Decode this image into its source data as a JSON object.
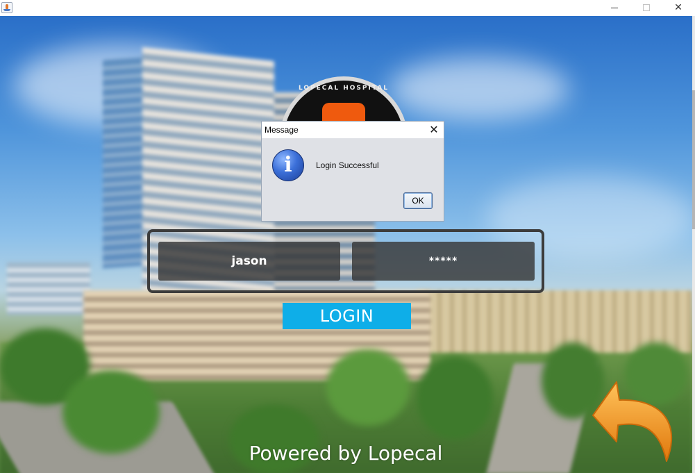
{
  "window": {
    "minimize_icon": "minimize-icon",
    "maximize_icon": "maximize-icon",
    "close_glyph": "✕"
  },
  "login": {
    "username_value": "jason",
    "password_value": "*****",
    "login_label": "LOGIN"
  },
  "logo": {
    "text": "LOPECAL HOSPITAL"
  },
  "footer": {
    "powered_by": "Powered by Lopecal"
  },
  "dialog": {
    "title": "Message",
    "close_glyph": "✕",
    "icon": "info-icon",
    "icon_glyph": "i",
    "message": "Login Successful",
    "ok_label": "OK"
  },
  "colors": {
    "login_button": "#0eaee8",
    "field_background": "#373737",
    "back_arrow": "#f39a1e",
    "info_icon": "#3b6fd8"
  }
}
